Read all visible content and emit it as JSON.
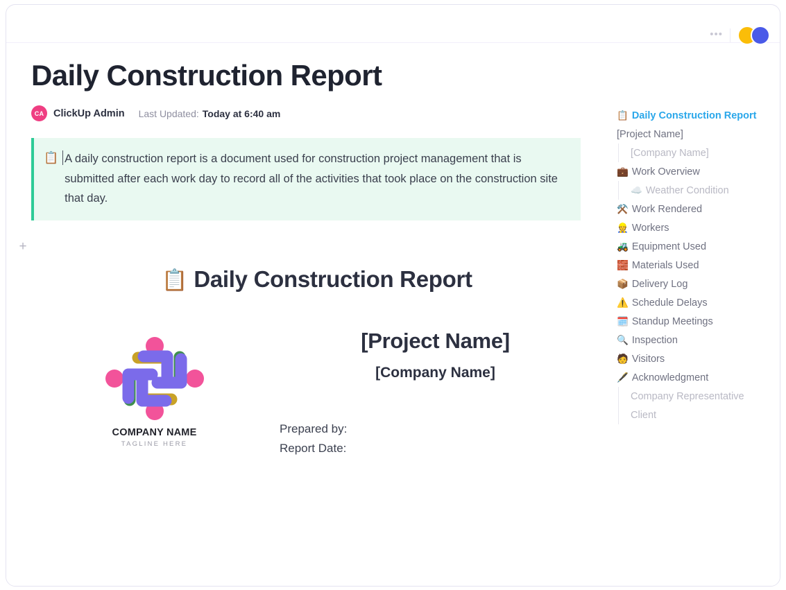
{
  "topbar": {
    "more_label": "•••",
    "avatars": [
      "yellow-avatar",
      "blue-avatar"
    ]
  },
  "document": {
    "title": "Daily Construction Report",
    "author_initials": "CA",
    "author": "ClickUp Admin",
    "updated_label": "Last Updated:",
    "updated_value": "Today at 6:40 am",
    "add_block_label": "+",
    "callout": {
      "icon": "📋",
      "text": "A daily construction report is a document used for construction project management that is submitted after each work day to record all of the activities that took place on the construction site that day."
    },
    "report_heading": {
      "icon": "📋",
      "text": "Daily Construction Report"
    },
    "logo": {
      "company": "COMPANY NAME",
      "tagline": "TAGLINE HERE"
    },
    "cover": {
      "project_name": "[Project Name]",
      "company_name": "[Company Name]",
      "prepared_by": "Prepared by:",
      "report_date": "Report Date:"
    }
  },
  "toc": {
    "items": [
      {
        "icon": "📋",
        "label": "Daily Construction Report",
        "level": 0,
        "active": true
      },
      {
        "icon": "",
        "label": "[Project Name]",
        "level": 1,
        "active": false
      },
      {
        "icon": "",
        "label": "[Company Name]",
        "level": 2,
        "active": false
      },
      {
        "icon": "💼",
        "label": "Work Overview",
        "level": 1,
        "active": false
      },
      {
        "icon": "☁️",
        "label": "Weather Condition",
        "level": 2,
        "active": false
      },
      {
        "icon": "⚒️",
        "label": "Work Rendered",
        "level": 1,
        "active": false
      },
      {
        "icon": "👷",
        "label": "Workers",
        "level": 1,
        "active": false
      },
      {
        "icon": "🚜",
        "label": "Equipment Used",
        "level": 1,
        "active": false
      },
      {
        "icon": "🧱",
        "label": "Materials Used",
        "level": 1,
        "active": false
      },
      {
        "icon": "📦",
        "label": "Delivery Log",
        "level": 1,
        "active": false
      },
      {
        "icon": "⚠️",
        "label": "Schedule Delays",
        "level": 1,
        "active": false
      },
      {
        "icon": "🗓️",
        "label": "Standup Meetings",
        "level": 1,
        "active": false
      },
      {
        "icon": "🔍",
        "label": "Inspection",
        "level": 1,
        "active": false
      },
      {
        "icon": "🧑",
        "label": "Visitors",
        "level": 1,
        "active": false
      },
      {
        "icon": "🖋️",
        "label": "Acknowledgment",
        "level": 1,
        "active": false
      },
      {
        "icon": "",
        "label": "Company Representative",
        "level": 2,
        "active": false
      },
      {
        "icon": "",
        "label": "Client",
        "level": 2,
        "active": false
      }
    ]
  },
  "colors": {
    "accent_blue": "#2aa7ea",
    "callout_bg": "#e9f9f1",
    "callout_border": "#2ecb97",
    "avatar_pink": "#ef3e82",
    "logo_purple": "#7b6bea",
    "logo_pink": "#f2539a",
    "logo_green": "#3f8f4f",
    "logo_olive": "#c9a227"
  }
}
